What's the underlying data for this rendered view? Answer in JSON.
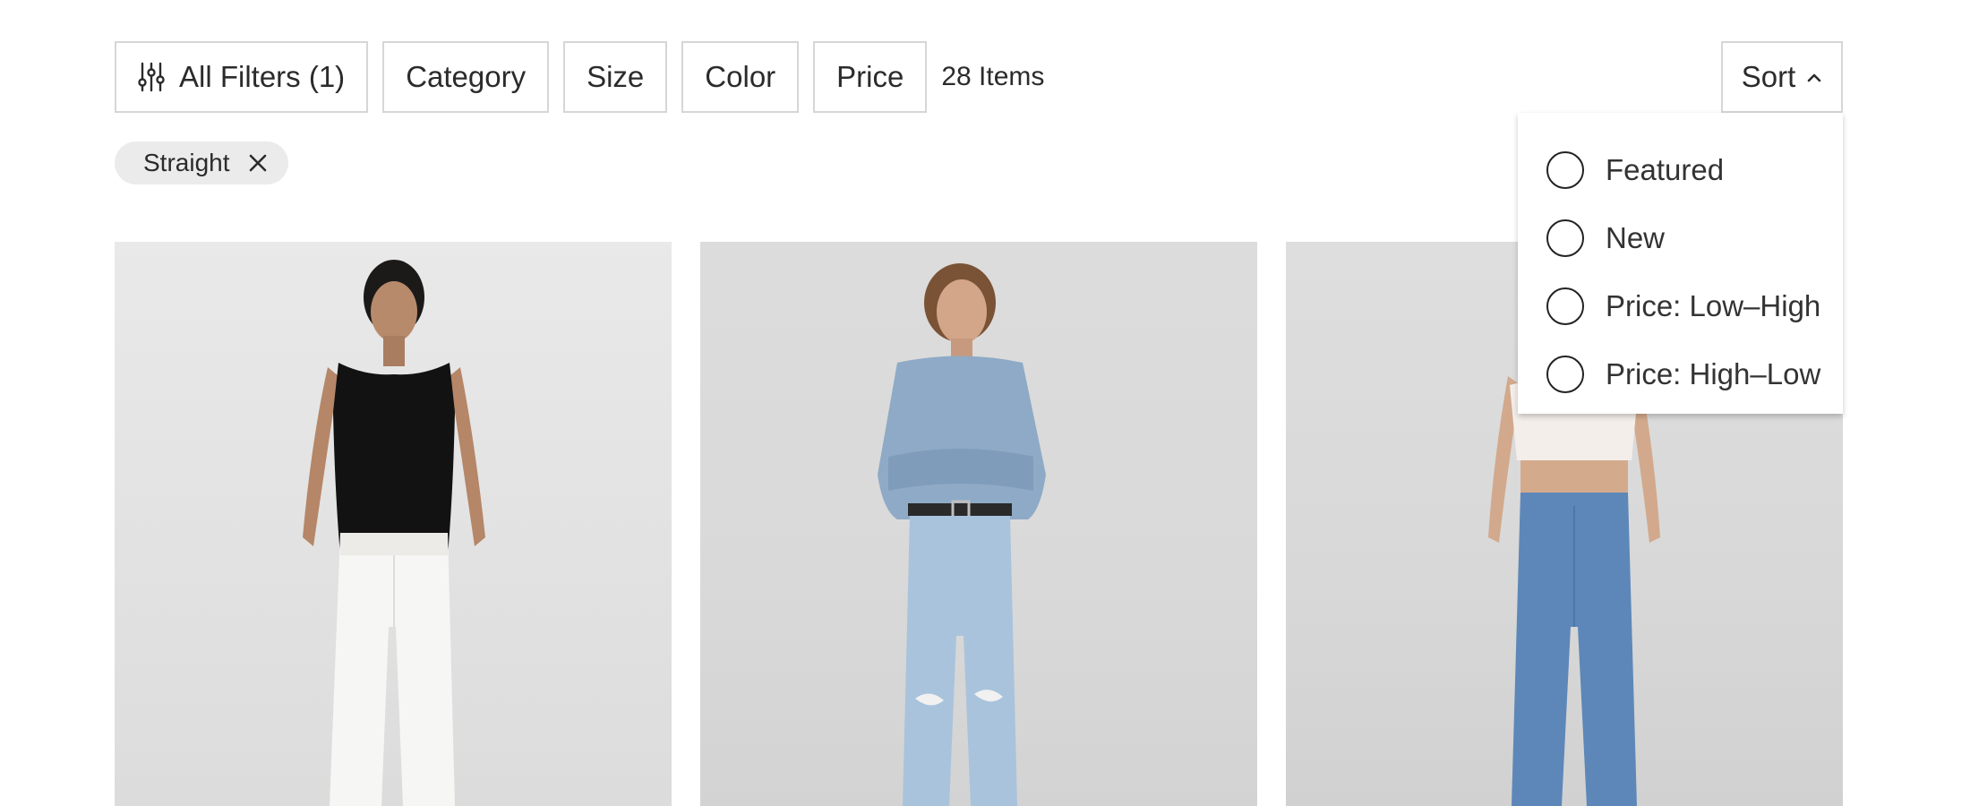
{
  "filters": {
    "buttons": [
      {
        "label": "All Filters (1)",
        "icon": "sliders-icon"
      },
      {
        "label": "Category"
      },
      {
        "label": "Size"
      },
      {
        "label": "Color"
      },
      {
        "label": "Price"
      }
    ],
    "items_count": "28 Items"
  },
  "sort": {
    "label": "Sort",
    "icon": "chevron-up-icon",
    "options": [
      "Featured",
      "New",
      "Price: Low–High",
      "Price: High–Low"
    ]
  },
  "active_filters": [
    {
      "label": "Straight",
      "icon": "close-icon"
    }
  ],
  "products": [
    {
      "image": "model-black-tank-white-jeans"
    },
    {
      "image": "model-denim-shirt-ripped-light-jeans"
    },
    {
      "image": "model-white-crop-tee-medium-wash-jeans"
    }
  ]
}
